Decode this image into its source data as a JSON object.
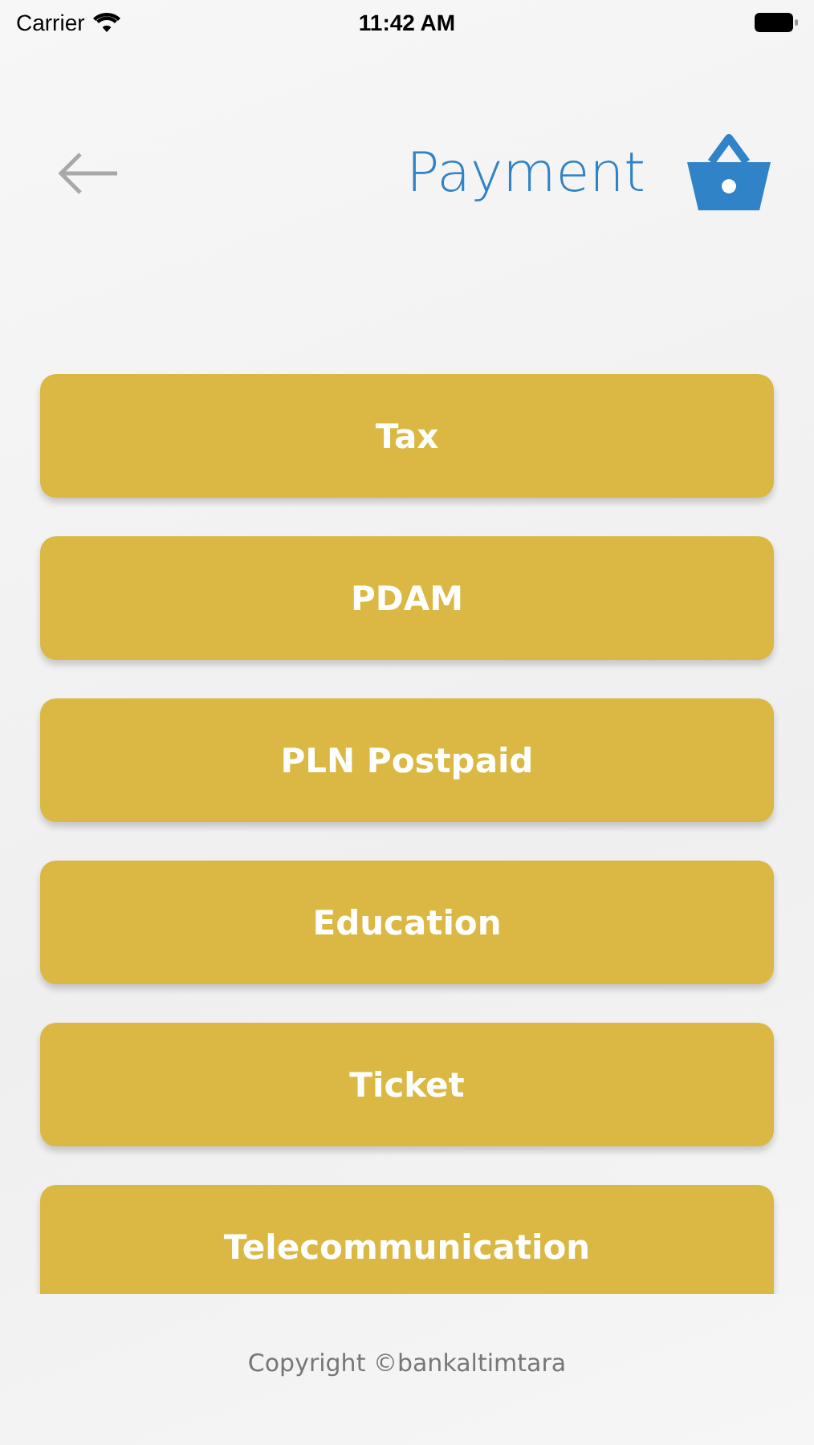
{
  "status_bar": {
    "carrier": "Carrier",
    "time": "11:42 AM"
  },
  "header": {
    "title": "Payment"
  },
  "menu": [
    {
      "label": "Tax"
    },
    {
      "label": "PDAM"
    },
    {
      "label": "PLN Postpaid"
    },
    {
      "label": "Education"
    },
    {
      "label": "Ticket"
    },
    {
      "label": "Telecommunication"
    }
  ],
  "footer": {
    "copyright": "Copyright ©bankaltimtara"
  }
}
